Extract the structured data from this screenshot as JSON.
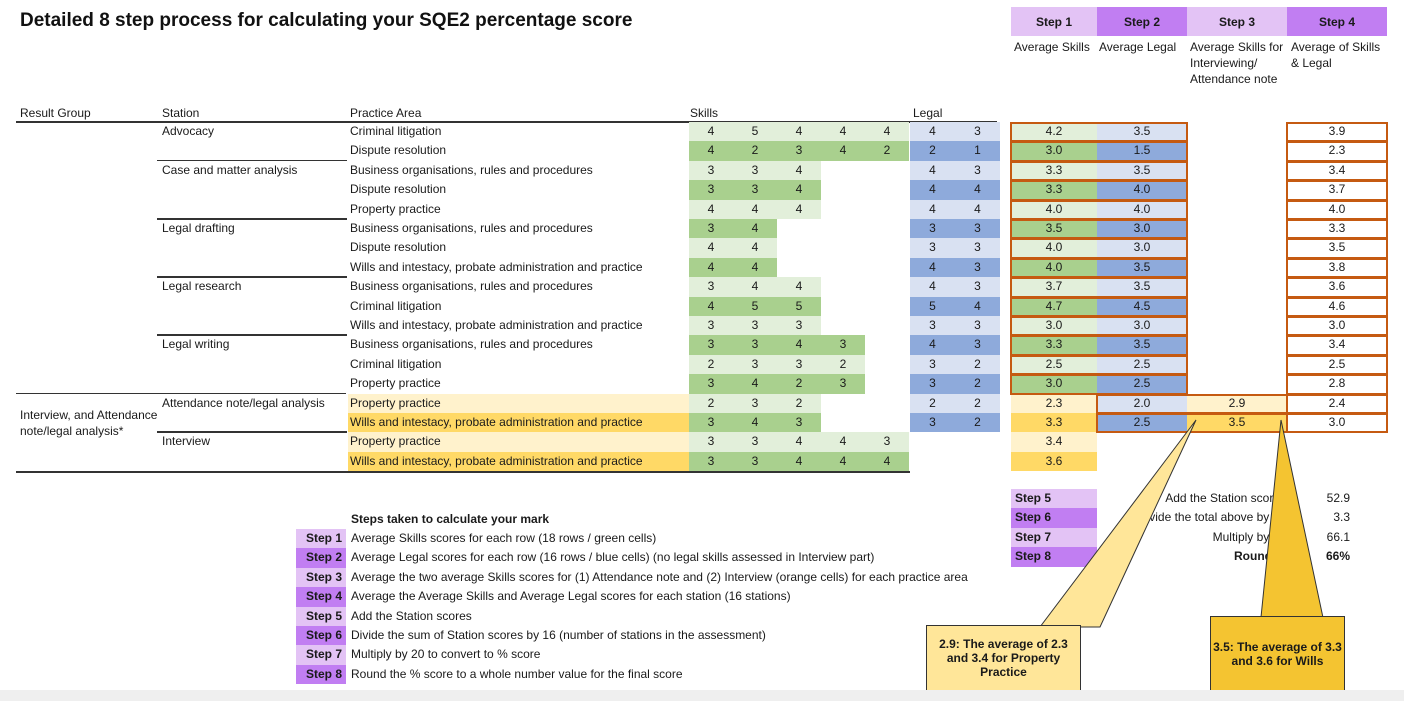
{
  "title": "Detailed 8 step process for calculating your SQE2 percentage score",
  "step_headers": [
    {
      "label": "Step 1",
      "desc": "Average Skills"
    },
    {
      "label": "Step 2",
      "desc": "Average Legal"
    },
    {
      "label": "Step 3",
      "desc": "Average Skills for Interviewing/ Attendance note"
    },
    {
      "label": "Step 4",
      "desc": "Average of Skills & Legal"
    }
  ],
  "columns": {
    "result_group": "Result Group",
    "station": "Station",
    "practice_area": "Practice Area",
    "skills": "Skills",
    "legal": "Legal"
  },
  "result_group_2": "Interview, and Attendance note/legal analysis*",
  "stations": [
    "Advocacy",
    "Case and matter analysis",
    "Legal drafting",
    "Legal research",
    "Legal writing",
    "Attendance note/legal analysis",
    "Interview"
  ],
  "rows": [
    {
      "area": "Criminal litigation",
      "skills": [
        "4",
        "5",
        "4",
        "4",
        "4"
      ],
      "legal": [
        "4",
        "3"
      ],
      "s1": "4.2",
      "s2": "3.5",
      "s3": "",
      "s4": "3.9"
    },
    {
      "area": "Dispute resolution",
      "skills": [
        "4",
        "2",
        "3",
        "4",
        "2"
      ],
      "legal": [
        "2",
        "1"
      ],
      "s1": "3.0",
      "s2": "1.5",
      "s3": "",
      "s4": "2.3"
    },
    {
      "area": "Business organisations, rules and procedures",
      "skills": [
        "3",
        "3",
        "4"
      ],
      "legal": [
        "4",
        "3"
      ],
      "s1": "3.3",
      "s2": "3.5",
      "s3": "",
      "s4": "3.4"
    },
    {
      "area": "Dispute resolution",
      "skills": [
        "3",
        "3",
        "4"
      ],
      "legal": [
        "4",
        "4"
      ],
      "s1": "3.3",
      "s2": "4.0",
      "s3": "",
      "s4": "3.7"
    },
    {
      "area": "Property practice",
      "skills": [
        "4",
        "4",
        "4"
      ],
      "legal": [
        "4",
        "4"
      ],
      "s1": "4.0",
      "s2": "4.0",
      "s3": "",
      "s4": "4.0"
    },
    {
      "area": "Business organisations, rules and procedures",
      "skills": [
        "3",
        "4"
      ],
      "legal": [
        "3",
        "3"
      ],
      "s1": "3.5",
      "s2": "3.0",
      "s3": "",
      "s4": "3.3"
    },
    {
      "area": "Dispute resolution",
      "skills": [
        "4",
        "4"
      ],
      "legal": [
        "3",
        "3"
      ],
      "s1": "4.0",
      "s2": "3.0",
      "s3": "",
      "s4": "3.5"
    },
    {
      "area": "Wills and intestacy, probate administration and practice",
      "skills": [
        "4",
        "4"
      ],
      "legal": [
        "4",
        "3"
      ],
      "s1": "4.0",
      "s2": "3.5",
      "s3": "",
      "s4": "3.8"
    },
    {
      "area": "Business organisations, rules and procedures",
      "skills": [
        "3",
        "4",
        "4"
      ],
      "legal": [
        "4",
        "3"
      ],
      "s1": "3.7",
      "s2": "3.5",
      "s3": "",
      "s4": "3.6"
    },
    {
      "area": "Criminal litigation",
      "skills": [
        "4",
        "5",
        "5"
      ],
      "legal": [
        "5",
        "4"
      ],
      "s1": "4.7",
      "s2": "4.5",
      "s3": "",
      "s4": "4.6"
    },
    {
      "area": "Wills and intestacy, probate administration and practice",
      "skills": [
        "3",
        "3",
        "3"
      ],
      "legal": [
        "3",
        "3"
      ],
      "s1": "3.0",
      "s2": "3.0",
      "s3": "",
      "s4": "3.0"
    },
    {
      "area": "Business organisations, rules and procedures",
      "skills": [
        "3",
        "3",
        "4",
        "3"
      ],
      "legal": [
        "4",
        "3"
      ],
      "s1": "3.3",
      "s2": "3.5",
      "s3": "",
      "s4": "3.4"
    },
    {
      "area": "Criminal litigation",
      "skills": [
        "2",
        "3",
        "3",
        "2"
      ],
      "legal": [
        "3",
        "2"
      ],
      "s1": "2.5",
      "s2": "2.5",
      "s3": "",
      "s4": "2.5"
    },
    {
      "area": "Property practice",
      "skills": [
        "3",
        "4",
        "2",
        "3"
      ],
      "legal": [
        "3",
        "2"
      ],
      "s1": "3.0",
      "s2": "2.5",
      "s3": "",
      "s4": "2.8"
    },
    {
      "area": "Property practice",
      "skills": [
        "2",
        "3",
        "2"
      ],
      "legal": [
        "2",
        "2"
      ],
      "s1": "2.3",
      "s2": "2.0",
      "s3": "2.9",
      "s4": "2.4"
    },
    {
      "area": "Wills and intestacy, probate administration and practice",
      "skills": [
        "3",
        "4",
        "3"
      ],
      "legal": [
        "3",
        "2"
      ],
      "s1": "3.3",
      "s2": "2.5",
      "s3": "3.5",
      "s4": "3.0"
    },
    {
      "area": "Property practice",
      "skills": [
        "3",
        "3",
        "4",
        "4",
        "3"
      ],
      "legal": [],
      "s1": "3.4",
      "s2": "",
      "s3": "",
      "s4": ""
    },
    {
      "area": "Wills and intestacy, probate administration and practice",
      "skills": [
        "3",
        "3",
        "4",
        "4",
        "4"
      ],
      "legal": [],
      "s1": "3.6",
      "s2": "",
      "s3": "",
      "s4": ""
    }
  ],
  "steps_title": "Steps taken to calculate your mark",
  "steps": [
    {
      "label": "Step 1",
      "text": "Average Skills scores for each row (18 rows / green cells)"
    },
    {
      "label": "Step 2",
      "text": "Average Legal scores for each row (16 rows / blue cells) (no legal skills assessed in Interview part)"
    },
    {
      "label": "Step 3",
      "text": "Average the two average Skills scores for (1) Attendance note  and (2) Interview (orange cells) for each practice area"
    },
    {
      "label": "Step 4",
      "text": "Average the Average Skills and Average Legal scores for each station (16 stations)"
    },
    {
      "label": "Step 5",
      "text": "Add the Station scores"
    },
    {
      "label": "Step 6",
      "text": "Divide the sum of Station scores by 16 (number of stations in the assessment)"
    },
    {
      "label": "Step 7",
      "text": "Multiply by 20 to convert to % score"
    },
    {
      "label": "Step 8",
      "text": "Round the % score to a whole number value for the final score"
    }
  ],
  "summary": [
    {
      "label": "Step 5",
      "desc": "Add the Station scores",
      "value": "52.9"
    },
    {
      "label": "Step 6",
      "desc": "Divide the total above by 16",
      "value": "3.3"
    },
    {
      "label": "Step 7",
      "desc": "Multiply by 20",
      "value": "66.1"
    },
    {
      "label": "Step 8",
      "desc": "Rounded",
      "value": "66%"
    }
  ],
  "callouts": {
    "property": "2.9: The average of 2.3 and 3.4 for Property Practice",
    "wills": "3.5: The average of 3.3 and 3.6 for Wills"
  },
  "colors": {
    "accent_orange": "#c55a11",
    "step_light": "#e3c3f5",
    "step_dark": "#c17ef2"
  }
}
